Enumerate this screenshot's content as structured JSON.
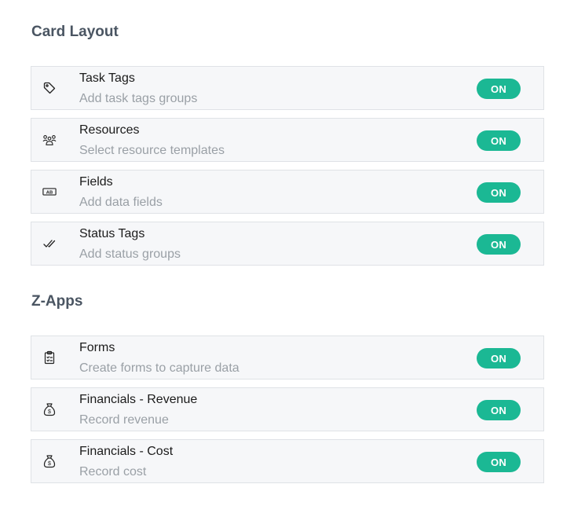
{
  "card_layout": {
    "title": "Card Layout",
    "items": [
      {
        "name": "Task Tags",
        "description": "Add task tags groups",
        "toggle": "ON",
        "icon": "tag-icon"
      },
      {
        "name": "Resources",
        "description": "Select resource templates",
        "toggle": "ON",
        "icon": "people-icon"
      },
      {
        "name": "Fields",
        "description": "Add data fields",
        "toggle": "ON",
        "icon": "fields-ab-icon"
      },
      {
        "name": "Status Tags",
        "description": "Add status groups",
        "toggle": "ON",
        "icon": "double-check-icon"
      }
    ]
  },
  "z_apps": {
    "title": "Z-Apps",
    "items": [
      {
        "name": "Forms",
        "description": "Create forms to capture data",
        "toggle": "ON",
        "icon": "clipboard-form-icon"
      },
      {
        "name": "Financials - Revenue",
        "description": "Record revenue",
        "toggle": "ON",
        "icon": "money-bag-icon"
      },
      {
        "name": "Financials - Cost",
        "description": "Record cost",
        "toggle": "ON",
        "icon": "money-bag-icon"
      }
    ]
  },
  "colors": {
    "toggle_on": "#1bb894",
    "row_bg": "#f6f7f9",
    "title": "#4a5562"
  }
}
